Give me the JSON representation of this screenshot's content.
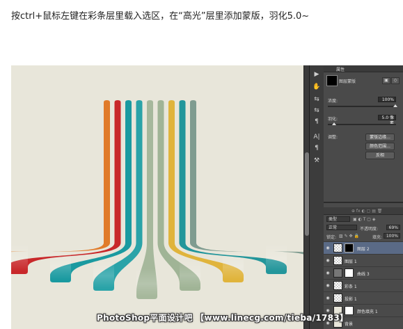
{
  "caption": "按ctrl+鼠标左键在彩条层里载入选区，在“高光”层里添加蒙版，羽化5.0~",
  "colors": {
    "canvas_bg": "#e8e6da",
    "stripes": [
      "#e07b2a",
      "#c8282a",
      "#1a9aa0",
      "#2aa3a8",
      "#a6b89c",
      "#a0b496",
      "#e0b43c",
      "#23969b",
      "#7f9c90"
    ]
  },
  "properties_panel": {
    "title": "属性",
    "mask_title": "图层蒙版",
    "density_label": "浓度:",
    "density_value": "100%",
    "feather_label": "羽化:",
    "feather_value": "5.0 像素",
    "refine_label": "调整:",
    "buttons": [
      "蒙版边缘...",
      "颜色范围...",
      "反相"
    ]
  },
  "layers_panel": {
    "filter_label": "类型",
    "blend_mode": "正常",
    "opacity_label": "不透明度:",
    "opacity_value": "69%",
    "lock_label": "锁定:",
    "fill_label": "填充:",
    "fill_value": "100%",
    "layers": [
      {
        "name": "图层 2",
        "active": true,
        "mask": "black"
      },
      {
        "name": "图层 1",
        "active": false,
        "mask": "none"
      },
      {
        "name": "曲线 3",
        "active": false,
        "mask": "white"
      },
      {
        "name": "彩条 1",
        "active": false,
        "mask": "none"
      },
      {
        "name": "投影 1",
        "active": false,
        "mask": "none"
      },
      {
        "name": "颜色填充 1",
        "active": false,
        "mask": "white"
      },
      {
        "name": "背景",
        "active": false,
        "mask": "none"
      }
    ]
  },
  "tools": [
    "▶",
    "✋",
    "⇆",
    "⇆",
    "¶",
    "A|",
    "¶",
    "⚒"
  ],
  "watermark": "PhotoShop平面设计吧 【www.linecg.com/tieba/1783】"
}
